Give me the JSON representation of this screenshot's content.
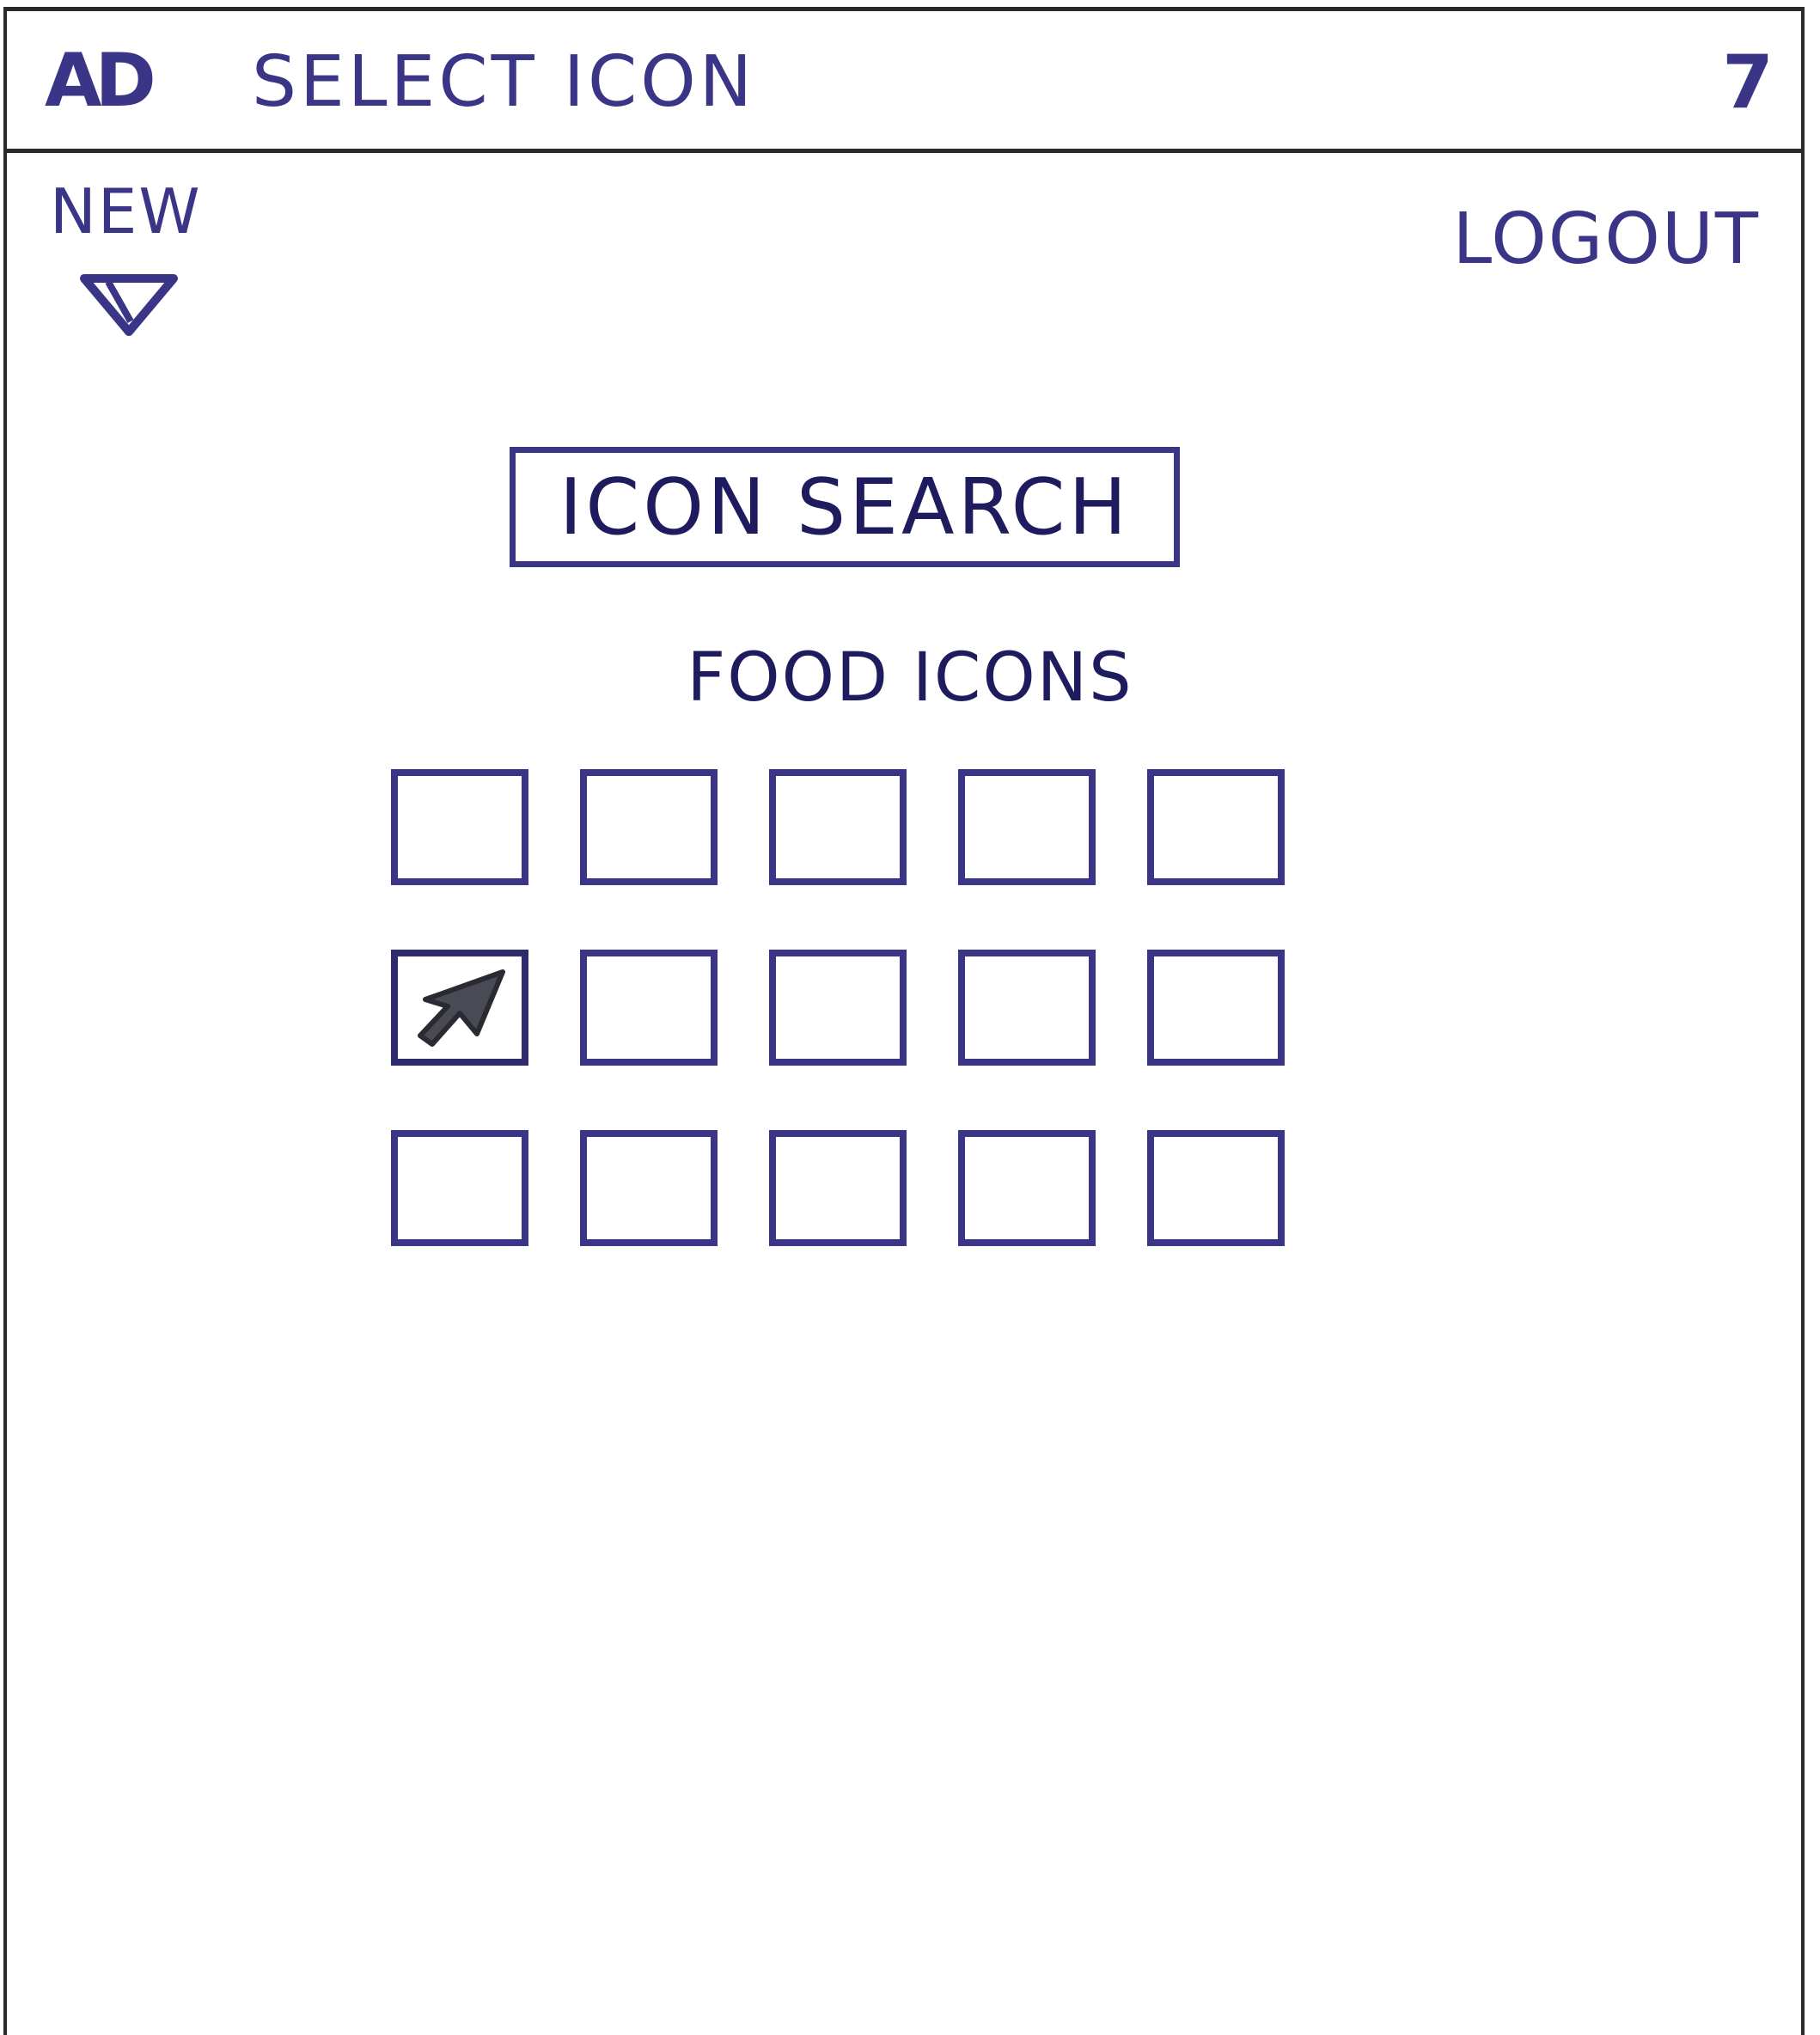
{
  "window": {
    "logo_text": "AD",
    "title": "SELECT ICON",
    "page_number": "7"
  },
  "header": {
    "new_label": "NEW",
    "new_icon": "chevron-down-icon",
    "logout_label": "LOGOUT"
  },
  "search": {
    "button_label": "ICON SEARCH"
  },
  "icons_section": {
    "heading": "FOOD ICONS",
    "rows": 3,
    "columns": 5,
    "selected_index": 5
  },
  "colors": {
    "ink": "#3b3587",
    "frame": "#2a2a2a",
    "background": "#ffffff"
  }
}
